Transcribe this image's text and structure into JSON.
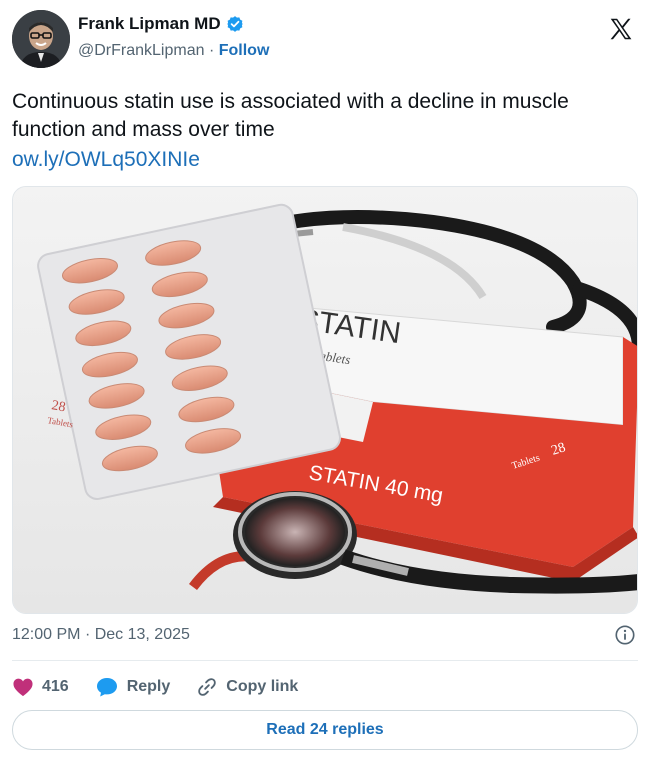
{
  "author": {
    "display_name": "Frank Lipman MD",
    "handle": "@DrFrankLipman",
    "separator": "·",
    "follow_label": "Follow",
    "verified": true
  },
  "tweet": {
    "text": "Continuous statin use is associated with a decline in muscle function and mass over time",
    "link": "ow.ly/OWLq50XINIe"
  },
  "media": {
    "box_brand": "STATIN",
    "box_subtitle": "Tablets",
    "box_side_label": "STATIN 40 mg",
    "box_count_label": "28",
    "box_count_sub": "Tablets",
    "blister_count_label": "28",
    "blister_count_sub": "Tablets"
  },
  "meta": {
    "time": "12:00 PM",
    "date": "Dec 13, 2025"
  },
  "actions": {
    "likes": "416",
    "reply_label": "Reply",
    "copy_label": "Copy link"
  },
  "read_replies_label": "Read 24 replies",
  "colors": {
    "link_blue": "#1d6fb8",
    "verified_blue": "#1d9bf0",
    "like_pink": "#c0307a",
    "muted": "#536471",
    "box_red": "#e0402f"
  }
}
